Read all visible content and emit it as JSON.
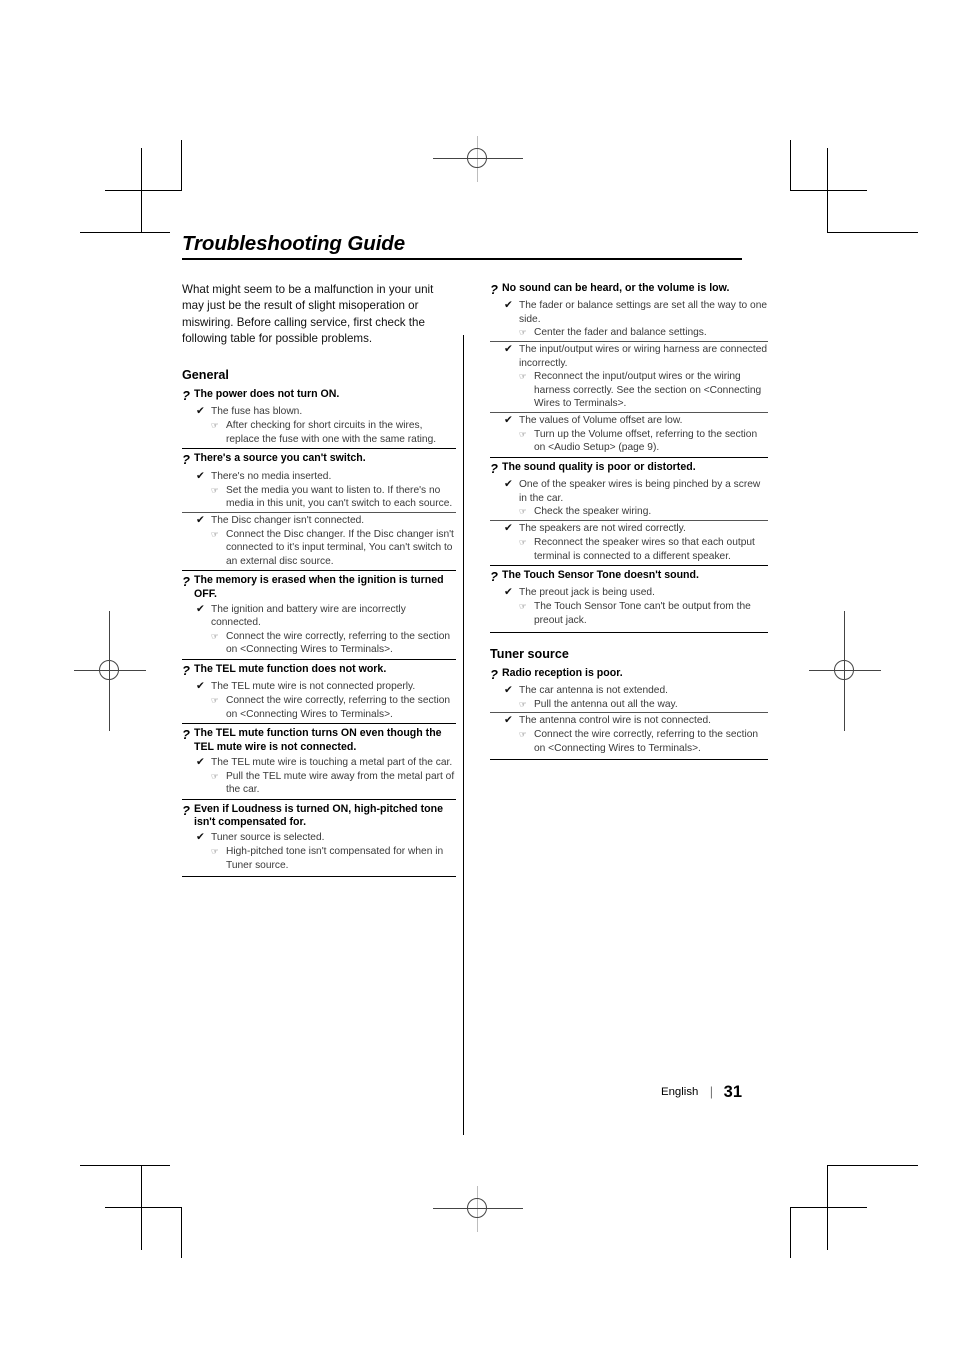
{
  "document": {
    "title": "Troubleshooting Guide",
    "intro": "What might seem to be a malfunction in your unit may just be the result of slight misoperation or miswiring. Before calling service, first check the following table for possible problems.",
    "footer": {
      "language": "English",
      "separator": "|",
      "page_number": "31"
    }
  },
  "markers": {
    "question": "?",
    "cause": "✔",
    "solution": "☞"
  },
  "left_column": {
    "section_heading": "General",
    "entries": [
      {
        "question": "The power does not turn ON.",
        "causes": [
          {
            "cause": "The fuse has blown.",
            "solutions": [
              "After checking for short circuits in the wires, replace the fuse with one with the same rating."
            ]
          }
        ]
      },
      {
        "question": "There's a source you can't switch.",
        "causes": [
          {
            "cause": "There's no media inserted.",
            "solutions": [
              "Set the media you want to listen to. If there's no media in this unit, you can't switch to each source."
            ]
          },
          {
            "cause": "The Disc changer isn't connected.",
            "solutions": [
              "Connect the Disc changer. If the Disc changer isn't connected to it's input terminal, You can't switch to an external disc source."
            ]
          }
        ]
      },
      {
        "question": "The memory is erased when the ignition is turned OFF.",
        "causes": [
          {
            "cause": "The ignition and battery wire are incorrectly connected.",
            "solutions": [
              "Connect the wire correctly, referring to the section on <Connecting Wires to Terminals>."
            ]
          }
        ]
      },
      {
        "question": "The TEL mute function does not work.",
        "causes": [
          {
            "cause": "The TEL mute wire is not connected properly.",
            "solutions": [
              "Connect the wire correctly, referring to the section on <Connecting Wires to Terminals>."
            ]
          }
        ]
      },
      {
        "question": "The TEL mute function turns ON even though the TEL mute wire is not connected.",
        "causes": [
          {
            "cause": "The TEL mute wire is touching a metal part of the car.",
            "solutions": [
              "Pull the TEL mute wire away from the metal part of the car."
            ]
          }
        ]
      },
      {
        "question": "Even if Loudness is turned ON, high-pitched tone isn't compensated for.",
        "causes": [
          {
            "cause": "Tuner source is selected.",
            "solutions": [
              "High-pitched tone isn't compensated for when in Tuner source."
            ]
          }
        ]
      }
    ]
  },
  "right_column": {
    "entries_top": [
      {
        "question": "No sound can be heard, or the volume is low.",
        "causes": [
          {
            "cause": "The fader or balance settings are set all the way to one side.",
            "solutions": [
              "Center the fader and balance settings."
            ]
          },
          {
            "cause": "The input/output wires or wiring harness are connected incorrectly.",
            "solutions": [
              "Reconnect the input/output wires or the wiring harness correctly. See the section on <Connecting Wires to Terminals>."
            ]
          },
          {
            "cause": "The values of Volume offset are low.",
            "solutions": [
              "Turn up the Volume offset, referring to the section on <Audio Setup> (page 9)."
            ]
          }
        ]
      },
      {
        "question": "The sound quality is poor or distorted.",
        "causes": [
          {
            "cause": "One of the speaker wires is being pinched by a screw in the car.",
            "solutions": [
              "Check the speaker wiring."
            ]
          },
          {
            "cause": "The speakers are not wired correctly.",
            "solutions": [
              "Reconnect the speaker wires so that each output terminal is connected to a different speaker."
            ]
          }
        ]
      },
      {
        "question": "The Touch Sensor Tone doesn't sound.",
        "causes": [
          {
            "cause": "The preout jack is being used.",
            "solutions": [
              "The Touch Sensor Tone can't be output from the preout jack."
            ]
          }
        ]
      }
    ],
    "section_heading": "Tuner source",
    "entries_bottom": [
      {
        "question": "Radio reception is poor.",
        "causes": [
          {
            "cause": "The car antenna is not extended.",
            "solutions": [
              "Pull the antenna out all the way."
            ]
          },
          {
            "cause": "The antenna control wire is not connected.",
            "solutions": [
              "Connect the wire correctly, referring to the section on <Connecting Wires to Terminals>."
            ]
          }
        ]
      }
    ]
  }
}
